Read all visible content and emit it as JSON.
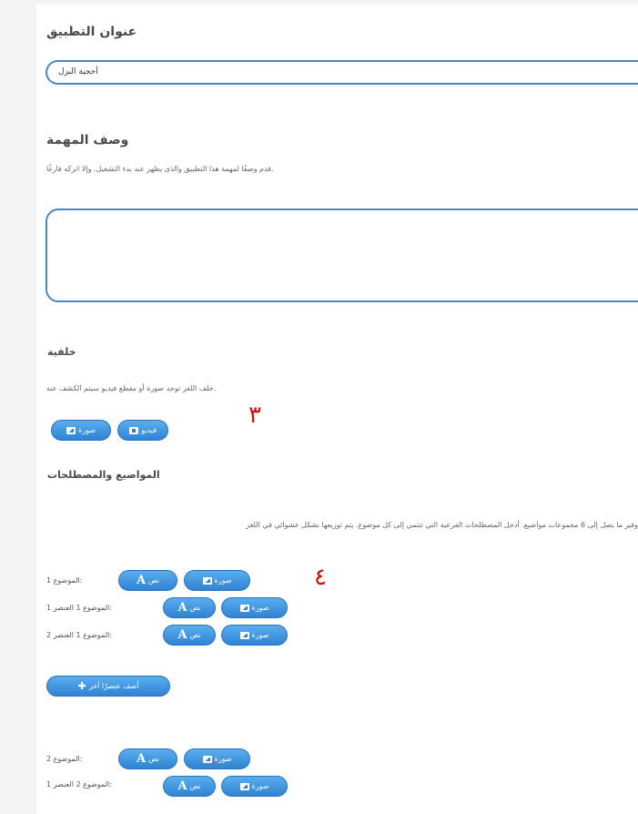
{
  "app_title": {
    "label": "عنوان التطبيق",
    "value": "أحجية البزل"
  },
  "task_description": {
    "label": "وصف المهمة",
    "hint": ".قدم وصفًا لمهمة هذا التطبيق والذى يظهر عند بدء التشغيل. وإلا اتركه فارغًا",
    "value": ""
  },
  "background": {
    "label": "خلفية",
    "hint": ".خلف اللغز توجد صورة أو مقطع فيديو سيتم الكشف عنه",
    "image_button": "صورة",
    "video_button": "فيديو"
  },
  "topics": {
    "label": "المواضيع والمصطلحات",
    "hint": "وفير ما يصل إلى 6 مجموعات مواضيع. أدخل المصطلحات الفرعية التي تنتمي إلى كل موضوع. يتم توزيعها بشكل عشوائي في اللغز",
    "image_button": "صورة",
    "text_button": "نص",
    "rows": [
      {
        "label": ":الموضوع 1"
      },
      {
        "label": ":الموضوع 1 العنصر 1"
      },
      {
        "label": ":الموضوع 1 العنصر 2"
      },
      {
        "label": ":الموضوع 2"
      },
      {
        "label": ":الموضوع 2 العنصر 1"
      }
    ],
    "add_item_button": "أضف عنصرًا آخر"
  },
  "annotations": {
    "marker_3": "٣",
    "marker_4": "٤"
  },
  "colors": {
    "accent": "#4a86c5",
    "button": "#2f83d3",
    "marker": "#cc1111"
  }
}
